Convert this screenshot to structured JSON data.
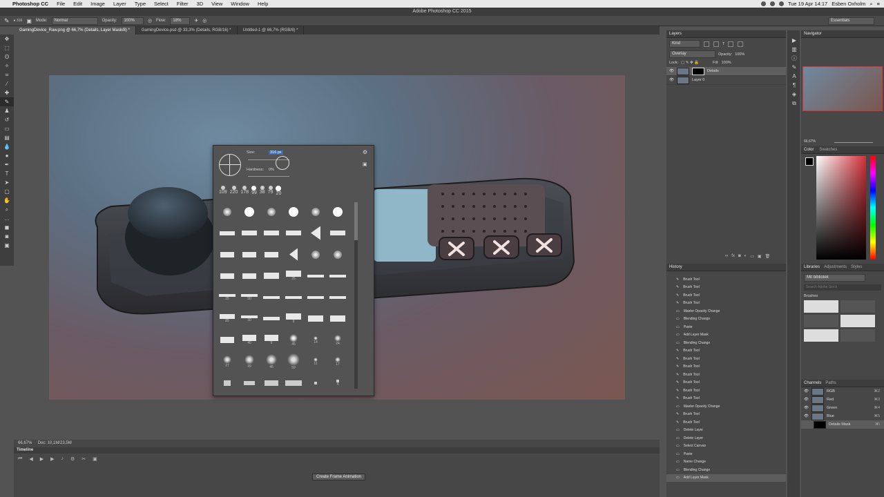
{
  "menubar": {
    "app_name": "Photoshop CC",
    "items": [
      "File",
      "Edit",
      "Image",
      "Layer",
      "Type",
      "Select",
      "Filter",
      "3D",
      "View",
      "Window",
      "Help"
    ],
    "clock": "Tue 19 Apr  14:17",
    "user": "Esben Oxholm"
  },
  "window_title": "Adobe Photoshop CC 2015",
  "options_bar": {
    "mode_label": "Mode:",
    "mode_value": "Normal",
    "opacity_label": "Opacity:",
    "opacity_value": "100%",
    "flow_label": "Flow:",
    "flow_value": "18%",
    "brush_size": "316",
    "workspace": "Essentials"
  },
  "doc_tabs": [
    "GamingDevice_Raw.png @ 66,7% (Details, Layer Mask/8) *",
    "GamingDevice.psd @ 33,3% (Details, RGB/16) *",
    "Untitled-1 @ 66,7% (RGB/8) *"
  ],
  "status_bar": {
    "zoom": "66,67%",
    "doc": "Doc: 10,1M/23,5M"
  },
  "timeline": {
    "title": "Timeline",
    "button_label": "Create Frame Animation"
  },
  "brush_popup": {
    "size_label": "Size:",
    "size_value": "316 px",
    "hardness_label": "Hardness:",
    "hardness_value": "0%",
    "preset_sizes": [
      "109",
      "220",
      "178",
      "99",
      "38",
      "79",
      "20"
    ],
    "grid_numbers": [
      "25",
      "25",
      "50",
      "85",
      "30",
      "9",
      "40",
      "9",
      "45",
      "14",
      "24",
      "27",
      "39",
      "46",
      "59",
      "11",
      "17",
      "4"
    ]
  },
  "layers": {
    "title": "Layers",
    "kind_label": "Kind",
    "blend_mode": "Overlay",
    "opacity_label": "Opacity:",
    "opacity_value": "100%",
    "lock_label": "Lock:",
    "fill_label": "Fill:",
    "fill_value": "100%",
    "items": [
      {
        "name": "Details",
        "selected": true
      },
      {
        "name": "Layer 0",
        "selected": false
      }
    ]
  },
  "history": {
    "title": "History",
    "items": [
      "Brush Tool",
      "Brush Tool",
      "Brush Tool",
      "Brush Tool",
      "Master Opacity Change",
      "Blending Change",
      "Paste",
      "Add Layer Mask",
      "Blending Change",
      "Brush Tool",
      "Brush Tool",
      "Brush Tool",
      "Brush Tool",
      "Brush Tool",
      "Brush Tool",
      "Brush Tool",
      "Master Opacity Change",
      "Brush Tool",
      "Brush Tool",
      "Delete Layer",
      "Delete Layer",
      "Select Canvas",
      "Paste",
      "Name Change",
      "Blending Change",
      "Add Layer Mask"
    ]
  },
  "navigator": {
    "title": "Navigator",
    "zoom": "66,67%"
  },
  "color": {
    "tabs": [
      "Color",
      "Swatches"
    ],
    "accent": "#d2303a"
  },
  "libraries": {
    "tabs": [
      "Libraries",
      "Adjustments",
      "Styles"
    ],
    "library_name": "Mit bibliotek",
    "search_placeholder": "Search Adobe Stock",
    "section": "Brushes"
  },
  "channels": {
    "tabs": [
      "Channels",
      "Paths"
    ],
    "items": [
      {
        "name": "RGB",
        "shortcut": "⌘2"
      },
      {
        "name": "Red",
        "shortcut": "⌘3"
      },
      {
        "name": "Green",
        "shortcut": "⌘4"
      },
      {
        "name": "Blue",
        "shortcut": "⌘5"
      },
      {
        "name": "Details Mask",
        "shortcut": "⌘\\"
      }
    ]
  }
}
